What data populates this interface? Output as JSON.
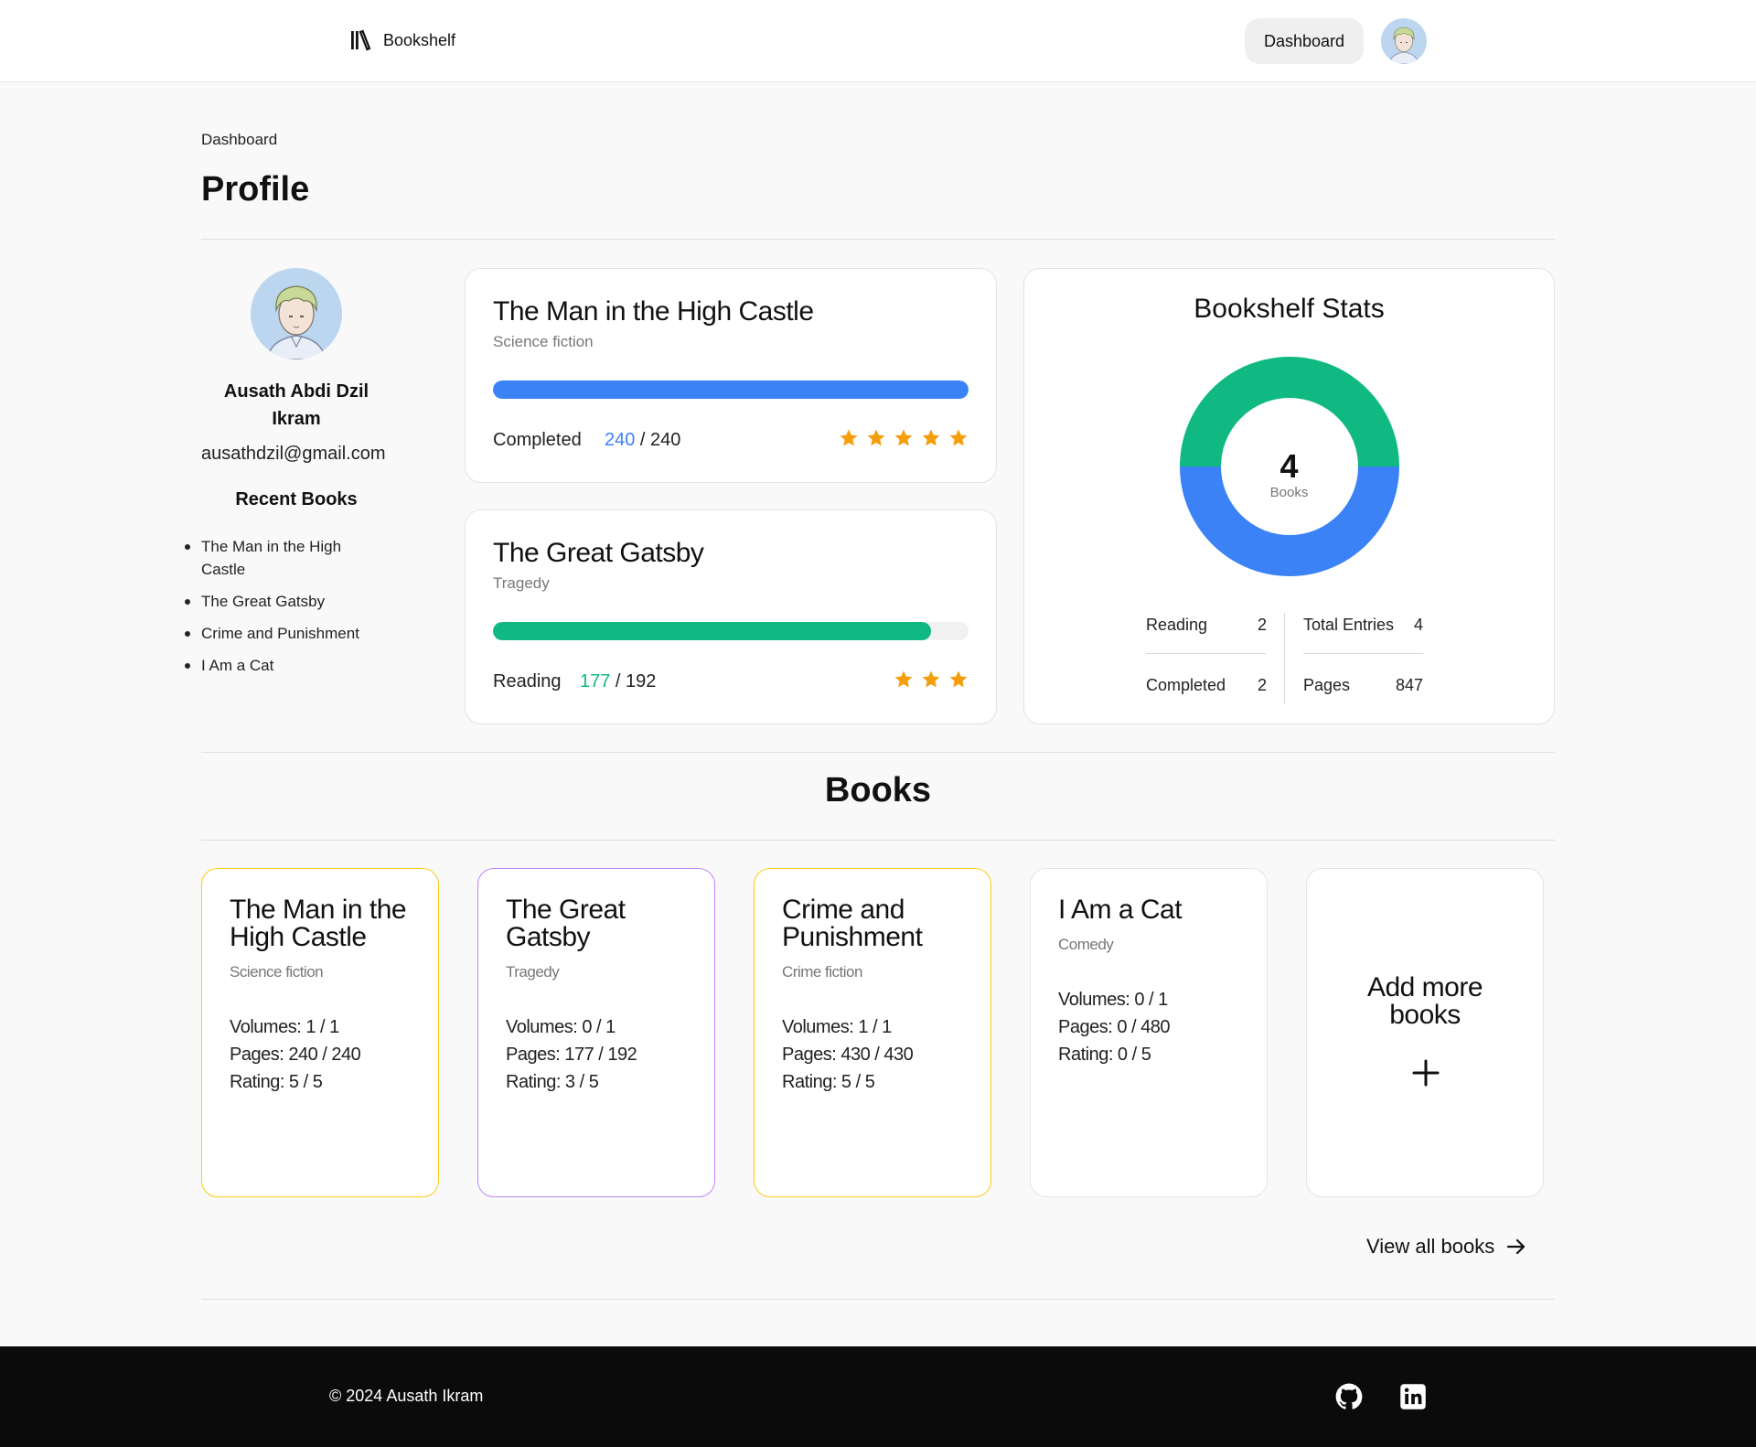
{
  "header": {
    "brand": "Bookshelf",
    "nav_button": "Dashboard"
  },
  "breadcrumb": "Dashboard",
  "page_title": "Profile",
  "profile": {
    "name": "Ausath Abdi Dzil Ikram",
    "email": "ausathdzil@gmail.com",
    "recent_title": "Recent Books",
    "recent_books": [
      "The Man in the High Castle",
      "The Great Gatsby",
      "Crime and Punishment",
      "I Am a Cat"
    ]
  },
  "reading_cards": [
    {
      "title": "The Man in the High Castle",
      "genre": "Science fiction",
      "status": "Completed",
      "pages_read": "240",
      "pages_sep": " / ",
      "pages_total": "240",
      "progress": 1.0,
      "color": "#3b82f6",
      "rating": 5
    },
    {
      "title": "The Great Gatsby",
      "genre": "Tragedy",
      "status": "Reading",
      "pages_read": "177",
      "pages_sep": " / ",
      "pages_total": "192",
      "progress": 0.922,
      "color": "#10b981",
      "rating": 3
    }
  ],
  "stats": {
    "title": "Bookshelf Stats",
    "center_value": "4",
    "center_label": "Books",
    "donut": [
      {
        "label": "Reading",
        "value": 2,
        "color": "#10b981"
      },
      {
        "label": "Completed",
        "value": 2,
        "color": "#3b82f6"
      }
    ],
    "items": {
      "reading_label": "Reading",
      "reading_value": "2",
      "completed_label": "Completed",
      "completed_value": "2",
      "total_label": "Total Entries",
      "total_value": "4",
      "pages_label": "Pages",
      "pages_value": "847"
    }
  },
  "books_section": {
    "title": "Books",
    "books": [
      {
        "title": "The Man in the High Castle",
        "genre": "Science fiction",
        "volumes": "Volumes: 1 / 1",
        "pages": "Pages: 240 / 240",
        "rating": "Rating: 5 / 5",
        "border": "#facc15"
      },
      {
        "title": "The Great Gatsby",
        "genre": "Tragedy",
        "volumes": "Volumes: 0 / 1",
        "pages": "Pages: 177 / 192",
        "rating": "Rating: 3 / 5",
        "border": "#c084fc"
      },
      {
        "title": "Crime and Punishment",
        "genre": "Crime fiction",
        "volumes": "Volumes: 1 / 1",
        "pages": "Pages: 430 / 430",
        "rating": "Rating: 5 / 5",
        "border": "#facc15"
      },
      {
        "title": "I Am a Cat",
        "genre": "Comedy",
        "volumes": "Volumes: 0 / 1",
        "pages": "Pages: 0 / 480",
        "rating": "Rating: 0 / 5",
        "border": "#e5e5e5"
      }
    ],
    "add_more": "Add more books",
    "view_all": "View all books"
  },
  "footer": {
    "copyright": "© 2024 Ausath Ikram",
    "icons": [
      "github-icon",
      "linkedin-icon"
    ]
  },
  "colors": {
    "accent_blue": "#3b82f6",
    "accent_green": "#10b981",
    "star": "#f59e0b",
    "footer_bg": "#0b0b0c"
  }
}
